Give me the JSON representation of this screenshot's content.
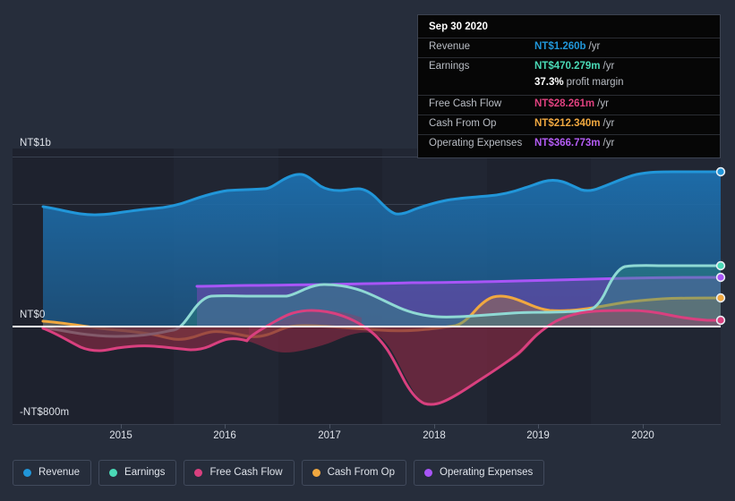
{
  "axis": {
    "y_labels": [
      "NT$1b",
      "NT$0",
      "-NT$800m"
    ],
    "y_top": "NT$1b",
    "y_zero": "NT$0",
    "y_bottom": "-NT$800m",
    "x_labels": [
      "2015",
      "2016",
      "2017",
      "2018",
      "2019",
      "2020"
    ]
  },
  "tooltip": {
    "date": "Sep 30 2020",
    "rows": [
      {
        "label": "Revenue",
        "value": "NT$1.260b",
        "unit": "/yr",
        "color": "#2196d9"
      },
      {
        "label": "Earnings",
        "value": "NT$470.279m",
        "unit": "/yr",
        "color": "#4ad9b6"
      },
      {
        "label": "",
        "value": "37.3%",
        "unit": "profit margin",
        "color": "#ffffff"
      },
      {
        "label": "Free Cash Flow",
        "value": "NT$28.261m",
        "unit": "/yr",
        "color": "#e0417f"
      },
      {
        "label": "Cash From Op",
        "value": "NT$212.340m",
        "unit": "/yr",
        "color": "#f0a840"
      },
      {
        "label": "Operating Expenses",
        "value": "NT$366.773m",
        "unit": "/yr",
        "color": "#b45cf5"
      }
    ],
    "r0_label": "Revenue",
    "r0_value": "NT$1.260b",
    "r0_unit": "/yr",
    "r1_label": "Earnings",
    "r1_value": "NT$470.279m",
    "r1_unit": "/yr",
    "r2_value": "37.3%",
    "r2_unit": "profit margin",
    "r3_label": "Free Cash Flow",
    "r3_value": "NT$28.261m",
    "r3_unit": "/yr",
    "r4_label": "Cash From Op",
    "r4_value": "NT$212.340m",
    "r4_unit": "/yr",
    "r5_label": "Operating Expenses",
    "r5_value": "NT$366.773m",
    "r5_unit": "/yr"
  },
  "legend": {
    "items": [
      {
        "label": "Revenue",
        "color": "#2196d9"
      },
      {
        "label": "Earnings",
        "color": "#4ad9b6"
      },
      {
        "label": "Free Cash Flow",
        "color": "#d9407f"
      },
      {
        "label": "Cash From Op",
        "color": "#f0a840"
      },
      {
        "label": "Operating Expenses",
        "color": "#a855f7"
      }
    ],
    "l0": "Revenue",
    "l1": "Earnings",
    "l2": "Free Cash Flow",
    "l3": "Cash From Op",
    "l4": "Operating Expenses"
  },
  "colors": {
    "background": "#262d3b",
    "plot_background": "#1e222e",
    "plot_background_alt": "#212633",
    "gridline": "#39404f",
    "zero_line": "#ffffff",
    "revenue": "#2196d9",
    "earnings": "#4ad9b6",
    "free_cash_flow": "#d9407f",
    "cash_from_op": "#f0a840",
    "operating_expenses": "#a855f7",
    "tooltip_background": "#060606",
    "tooltip_border": "#3c4250"
  },
  "chart_data": {
    "type": "area",
    "title": "",
    "subtitle": "",
    "xlabel": "",
    "ylabel": "",
    "currency": "NTD",
    "unit": "per year",
    "grid": true,
    "legend_position": "bottom",
    "xlim": [
      "2014-09",
      "2020-09"
    ],
    "ylim": [
      -800000000,
      1000000000
    ],
    "y_ticks": [
      1000000000,
      0,
      -800000000
    ],
    "y_tick_labels": [
      "NT$1b",
      "NT$0",
      "-NT$800m"
    ],
    "x_ticks": [
      "2015",
      "2016",
      "2017",
      "2018",
      "2019",
      "2020"
    ],
    "x": [
      "2014-09",
      "2014-12",
      "2015-03",
      "2015-06",
      "2015-09",
      "2015-12",
      "2016-03",
      "2016-06",
      "2016-09",
      "2016-12",
      "2017-03",
      "2017-06",
      "2017-09",
      "2017-12",
      "2018-03",
      "2018-06",
      "2018-09",
      "2018-12",
      "2019-03",
      "2019-06",
      "2019-09",
      "2019-12",
      "2020-03",
      "2020-06",
      "2020-09"
    ],
    "series": [
      {
        "name": "Revenue",
        "color": "#2196d9",
        "end_value": "NT$1.260b",
        "values": [
          705,
          690,
          665,
          650,
          648,
          658,
          700,
          740,
          760,
          768,
          772,
          790,
          832,
          800,
          790,
          792,
          740,
          705,
          712,
          748,
          760,
          775,
          790,
          830,
          1260
        ]
      },
      {
        "name": "Earnings",
        "color": "#4ad9b6",
        "end_value": "NT$470.279m",
        "values": [
          -5,
          -20,
          -45,
          -55,
          -45,
          -20,
          140,
          155,
          152,
          150,
          175,
          188,
          185,
          170,
          118,
          72,
          55,
          48,
          90,
          140,
          155,
          80,
          70,
          120,
          470
        ]
      },
      {
        "name": "Free Cash Flow",
        "color": "#d9407f",
        "end_value": "NT$28.261m",
        "values": [
          -10,
          -55,
          -130,
          -135,
          -132,
          -120,
          -65,
          -60,
          -150,
          -155,
          -100,
          -10,
          10,
          -30,
          -200,
          -455,
          -430,
          -300,
          -120,
          -55,
          -95,
          -40,
          -40,
          -15,
          28
        ]
      },
      {
        "name": "Cash From Op",
        "color": "#f0a840",
        "end_value": "NT$212.340m",
        "values": [
          30,
          15,
          -20,
          -30,
          -25,
          -15,
          -75,
          -78,
          -60,
          45,
          65,
          55,
          20,
          22,
          15,
          18,
          20,
          150,
          185,
          95,
          40,
          110,
          160,
          180,
          212
        ]
      },
      {
        "name": "Operating Expenses",
        "color": "#a855f7",
        "end_value": "NT$366.773m",
        "values": [
          null,
          null,
          null,
          null,
          null,
          null,
          240,
          243,
          245,
          248,
          250,
          255,
          258,
          262,
          268,
          272,
          278,
          285,
          292,
          300,
          310,
          320,
          335,
          350,
          367
        ]
      }
    ]
  }
}
